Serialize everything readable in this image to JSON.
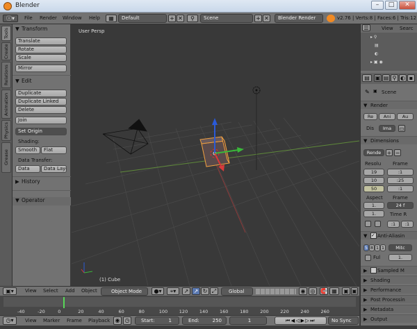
{
  "window": {
    "title": "Blender"
  },
  "menu": {
    "file": "File",
    "render": "Render",
    "window": "Window",
    "help": "Help"
  },
  "screen_layout": "Default",
  "scene": "Scene",
  "render_engine": "Blender Render",
  "stats": "v2.76 | Verts:8 | Faces:6 | Tris:12",
  "tool_tabs": [
    "Tools",
    "Create",
    "Relations",
    "Animation",
    "Physics",
    "Grease Pencil"
  ],
  "shelf": {
    "transform_title": "Transform",
    "translate": "Translate",
    "rotate": "Rotate",
    "scale": "Scale",
    "mirror": "Mirror",
    "edit_title": "Edit",
    "duplicate": "Duplicate",
    "duplicate_linked": "Duplicate Linked",
    "delete": "Delete",
    "join": "Join",
    "set_origin": "Set Origin",
    "shading_label": "Shading:",
    "smooth": "Smooth",
    "flat": "Flat",
    "data_transfer_label": "Data Transfer:",
    "data": "Data",
    "data_layout": "Data Layo",
    "history_title": "History",
    "operator_title": "Operator"
  },
  "viewport": {
    "label": "User Persp",
    "object_label": "(1) Cube"
  },
  "outliner": {
    "view": "View",
    "search": "Searc"
  },
  "properties": {
    "scene_label": "Scene",
    "render_title": "Render",
    "display_label": "Dis",
    "display_value": "Ima",
    "render_btn_1": "Re",
    "render_btn_2": "Ani",
    "render_btn_3": "Au",
    "dimensions_title": "Dimensions",
    "preset": "Rende",
    "resolution_label": "Resolu",
    "frame_label": "Frame",
    "res_x": "19",
    "res_y": "10",
    "res_pct": "50",
    "frame_start": ":1",
    "frame_end": ":25",
    "frame_step": ":1",
    "aspect_label": "Aspect",
    "aspect_x": "1.",
    "aspect_y": "1.",
    "frame_rate_label": "Frame",
    "frame_rate": "24 f",
    "time_remap_label": "Time R",
    "time_old": ":1",
    "time_new": ":1",
    "anti_aliasing_title": "Anti-Aliasin",
    "aa_5": "5",
    "aa_8": "8",
    "aa_1": "1",
    "aa_1b": "1",
    "aa_filter": "Mitc",
    "full_label": "Ful",
    "aa_size": "1.",
    "sampled_title": "Sampled M",
    "shading_title": "Shading",
    "performance_title": "Performance",
    "post_processing_title": "Post Processin",
    "metadata_title": "Metadata",
    "output_title": "Output"
  },
  "view_header": {
    "view": "View",
    "select": "Select",
    "add": "Add",
    "object": "Object",
    "mode": "Object Mode",
    "orientation": "Global"
  },
  "timeline": {
    "ticks": [
      "-40",
      "-20",
      "0",
      "20",
      "40",
      "60",
      "80",
      "100",
      "120",
      "140",
      "160",
      "180",
      "200",
      "220",
      "240",
      "260"
    ],
    "current_frame_value": 0
  },
  "timeline_header": {
    "view": "View",
    "marker": "Marker",
    "frame": "Frame",
    "playback": "Playback",
    "start_label": "Start:",
    "start_value": "1",
    "end_label": "End:",
    "end_value": "250",
    "current_value": "1",
    "sync": "No Sync"
  }
}
